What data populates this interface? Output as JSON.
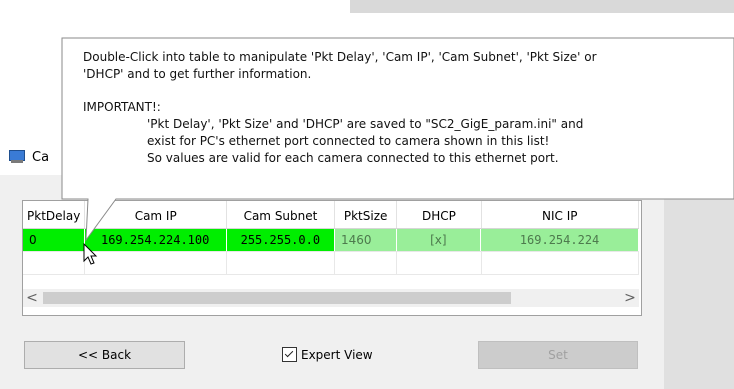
{
  "window": {
    "title_partial": "Ca"
  },
  "tooltip": {
    "line1": "Double-Click into table to manipulate 'Pkt Delay', 'Cam IP', 'Cam Subnet', 'Pkt Size' or",
    "line2": "'DHCP' and to get further information.",
    "important": "IMPORTANT!:",
    "note1": "'Pkt Delay', 'Pkt Size' and 'DHCP' are saved to \"SC2_GigE_param.ini\" and",
    "note2": "exist for PC's ethernet port connected to camera shown in this list!",
    "note3": "So values are valid for each camera connected to this ethernet port."
  },
  "table": {
    "columns": [
      "PktDelay",
      "Cam IP",
      "Cam Subnet",
      "PktSize",
      "DHCP",
      "NIC IP"
    ],
    "rows": [
      {
        "pkt_delay": "0",
        "cam_ip": "169.254.224.100",
        "cam_subnet": "255.255.0.0",
        "pkt_size": "1460",
        "dhcp": "[x]",
        "nic_ip": "169.254.224"
      }
    ]
  },
  "scrollbar": {
    "left_arrow": "<",
    "right_arrow": ">"
  },
  "buttons": {
    "back_label": "<< Back",
    "set_label": "Set"
  },
  "expert_view": {
    "label": "Expert View",
    "checked": true
  },
  "colors": {
    "row_active": "#00ee00",
    "row_readonly": "#99ee99"
  }
}
